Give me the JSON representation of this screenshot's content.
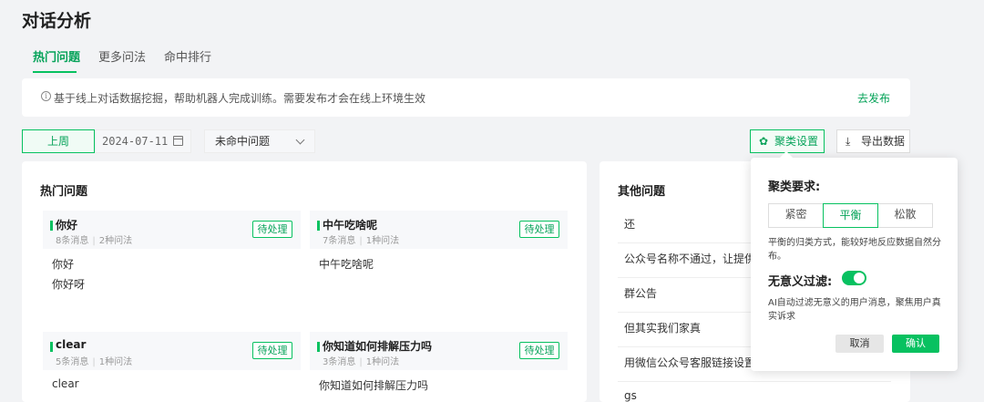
{
  "page": {
    "title": "对话分析"
  },
  "tabs": [
    {
      "label": "热门问题"
    },
    {
      "label": "更多问法"
    },
    {
      "label": "命中排行"
    }
  ],
  "notice": {
    "icon": "info-icon",
    "text": "基于线上对话数据挖掘，帮助机器人完成训练。需要发布才会在线上环境生效",
    "link": "去发布"
  },
  "filters": {
    "week_label": "上周",
    "date_value": "2024-07-11",
    "select_value": "未命中问题"
  },
  "toolbar": {
    "cluster_label": "聚类设置",
    "export_label": "导出数据"
  },
  "hot": {
    "title": "热门问题",
    "cards": [
      {
        "title": "你好",
        "messages": "8条消息",
        "variants": "2种问法",
        "status": "待处理",
        "lines": [
          "你好",
          "你好呀"
        ]
      },
      {
        "title": "中午吃啥呢",
        "messages": "7条消息",
        "variants": "1种问法",
        "status": "待处理",
        "lines": [
          "中午吃啥呢"
        ]
      },
      {
        "title": "clear",
        "messages": "5条消息",
        "variants": "1种问法",
        "status": "待处理",
        "lines": [
          "clear"
        ]
      },
      {
        "title": "你知道如何排解压力吗",
        "messages": "3条消息",
        "variants": "1种问法",
        "status": "待处理",
        "lines": [
          "你知道如何排解压力吗"
        ]
      }
    ]
  },
  "other": {
    "title": "其他问题",
    "items": [
      "还",
      "公众号名称不通过，让提供",
      "群公告",
      "但其实我们家真",
      "用微信公众号客服链接设置",
      "gs"
    ]
  },
  "popover": {
    "cluster_label": "聚类要求:",
    "options": [
      "紧密",
      "平衡",
      "松散"
    ],
    "selected": "平衡",
    "cluster_desc": "平衡的归类方式，能较好地反应数据自然分布。",
    "filter_label": "无意义过滤:",
    "filter_on": true,
    "filter_desc": "AI自动过滤无意义的用户消息，聚焦用户真实诉求",
    "cancel": "取消",
    "confirm": "确认"
  },
  "colors": {
    "accent": "#07c160",
    "accent_text": "#07a35a"
  }
}
